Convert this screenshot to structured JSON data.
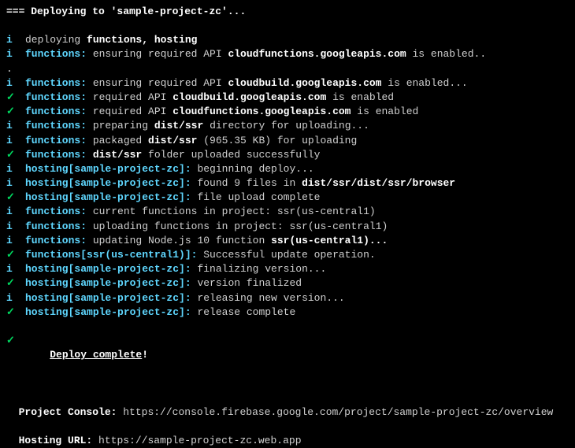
{
  "header": "=== Deploying to 'sample-project-zc'...",
  "deploy_complete_prefix": "Deploy complete",
  "deploy_complete_suffix": "!",
  "project_console_label": "Project Console:",
  "project_console_url": "https://console.firebase.google.com/project/sample-project-zc/overview",
  "hosting_url_label": "Hosting URL:",
  "hosting_url": "https://sample-project-zc.web.app",
  "lines": {
    "l0": {
      "icon": "i",
      "parts": [
        {
          "t": "deploying ",
          "c": "normal"
        },
        {
          "t": "functions, hosting",
          "c": "white-bold"
        }
      ]
    },
    "l1": {
      "icon": "i",
      "parts": [
        {
          "t": "functions:",
          "c": "cyan-bold"
        },
        {
          "t": " ensuring required API ",
          "c": "normal"
        },
        {
          "t": "cloudfunctions.googleapis.com",
          "c": "white-bold"
        },
        {
          "t": " is enabled..",
          "c": "normal"
        }
      ]
    },
    "l1b": {
      "icon": "",
      "parts": [
        {
          "t": ".",
          "c": "normal"
        }
      ],
      "noindent": true
    },
    "l2": {
      "icon": "i",
      "parts": [
        {
          "t": "functions:",
          "c": "cyan-bold"
        },
        {
          "t": " ensuring required API ",
          "c": "normal"
        },
        {
          "t": "cloudbuild.googleapis.com",
          "c": "white-bold"
        },
        {
          "t": " is enabled...",
          "c": "normal"
        }
      ]
    },
    "l3": {
      "icon": "✓",
      "parts": [
        {
          "t": "functions:",
          "c": "cyan-bold"
        },
        {
          "t": " required API ",
          "c": "normal"
        },
        {
          "t": "cloudbuild.googleapis.com",
          "c": "white-bold"
        },
        {
          "t": " is enabled",
          "c": "normal"
        }
      ]
    },
    "l4": {
      "icon": "✓",
      "parts": [
        {
          "t": "functions:",
          "c": "cyan-bold"
        },
        {
          "t": " required API ",
          "c": "normal"
        },
        {
          "t": "cloudfunctions.googleapis.com",
          "c": "white-bold"
        },
        {
          "t": " is enabled",
          "c": "normal"
        }
      ]
    },
    "l5": {
      "icon": "i",
      "parts": [
        {
          "t": "functions:",
          "c": "cyan-bold"
        },
        {
          "t": " preparing ",
          "c": "normal"
        },
        {
          "t": "dist/ssr",
          "c": "white-bold"
        },
        {
          "t": " directory for uploading...",
          "c": "normal"
        }
      ]
    },
    "l6": {
      "icon": "i",
      "parts": [
        {
          "t": "functions:",
          "c": "cyan-bold"
        },
        {
          "t": " packaged ",
          "c": "normal"
        },
        {
          "t": "dist/ssr",
          "c": "white-bold"
        },
        {
          "t": " (965.35 KB) for uploading",
          "c": "normal"
        }
      ]
    },
    "l7": {
      "icon": "✓",
      "parts": [
        {
          "t": "functions:",
          "c": "cyan-bold"
        },
        {
          "t": " ",
          "c": "normal"
        },
        {
          "t": "dist/ssr",
          "c": "white-bold"
        },
        {
          "t": " folder uploaded successfully",
          "c": "normal"
        }
      ]
    },
    "l8": {
      "icon": "i",
      "parts": [
        {
          "t": "hosting[sample-project-zc]:",
          "c": "cyan-bold"
        },
        {
          "t": " beginning deploy...",
          "c": "normal"
        }
      ]
    },
    "l9": {
      "icon": "i",
      "parts": [
        {
          "t": "hosting[sample-project-zc]:",
          "c": "cyan-bold"
        },
        {
          "t": " found 9 files in ",
          "c": "normal"
        },
        {
          "t": "dist/ssr/dist/ssr/browser",
          "c": "white-bold"
        }
      ]
    },
    "l10": {
      "icon": "✓",
      "parts": [
        {
          "t": "hosting[sample-project-zc]:",
          "c": "cyan-bold"
        },
        {
          "t": " file upload complete",
          "c": "normal"
        }
      ]
    },
    "l11": {
      "icon": "i",
      "parts": [
        {
          "t": "functions:",
          "c": "cyan-bold"
        },
        {
          "t": " current functions in project: ssr(us-central1)",
          "c": "normal"
        }
      ]
    },
    "l12": {
      "icon": "i",
      "parts": [
        {
          "t": "functions:",
          "c": "cyan-bold"
        },
        {
          "t": " uploading functions in project: ssr(us-central1)",
          "c": "normal"
        }
      ]
    },
    "l13": {
      "icon": "i",
      "parts": [
        {
          "t": "functions:",
          "c": "cyan-bold"
        },
        {
          "t": " updating Node.js 10 function ",
          "c": "normal"
        },
        {
          "t": "ssr(us-central1)...",
          "c": "white-bold"
        }
      ]
    },
    "l14": {
      "icon": "✓",
      "parts": [
        {
          "t": "functions[ssr(us-central1)]:",
          "c": "cyan-bold"
        },
        {
          "t": " Successful update operation.",
          "c": "normal"
        }
      ]
    },
    "l15": {
      "icon": "i",
      "parts": [
        {
          "t": "hosting[sample-project-zc]:",
          "c": "cyan-bold"
        },
        {
          "t": " finalizing version...",
          "c": "normal"
        }
      ]
    },
    "l16": {
      "icon": "✓",
      "parts": [
        {
          "t": "hosting[sample-project-zc]:",
          "c": "cyan-bold"
        },
        {
          "t": " version finalized",
          "c": "normal"
        }
      ]
    },
    "l17": {
      "icon": "i",
      "parts": [
        {
          "t": "hosting[sample-project-zc]:",
          "c": "cyan-bold"
        },
        {
          "t": " releasing new version...",
          "c": "normal"
        }
      ]
    },
    "l18": {
      "icon": "✓",
      "parts": [
        {
          "t": "hosting[sample-project-zc]:",
          "c": "cyan-bold"
        },
        {
          "t": " release complete",
          "c": "normal"
        }
      ]
    }
  }
}
